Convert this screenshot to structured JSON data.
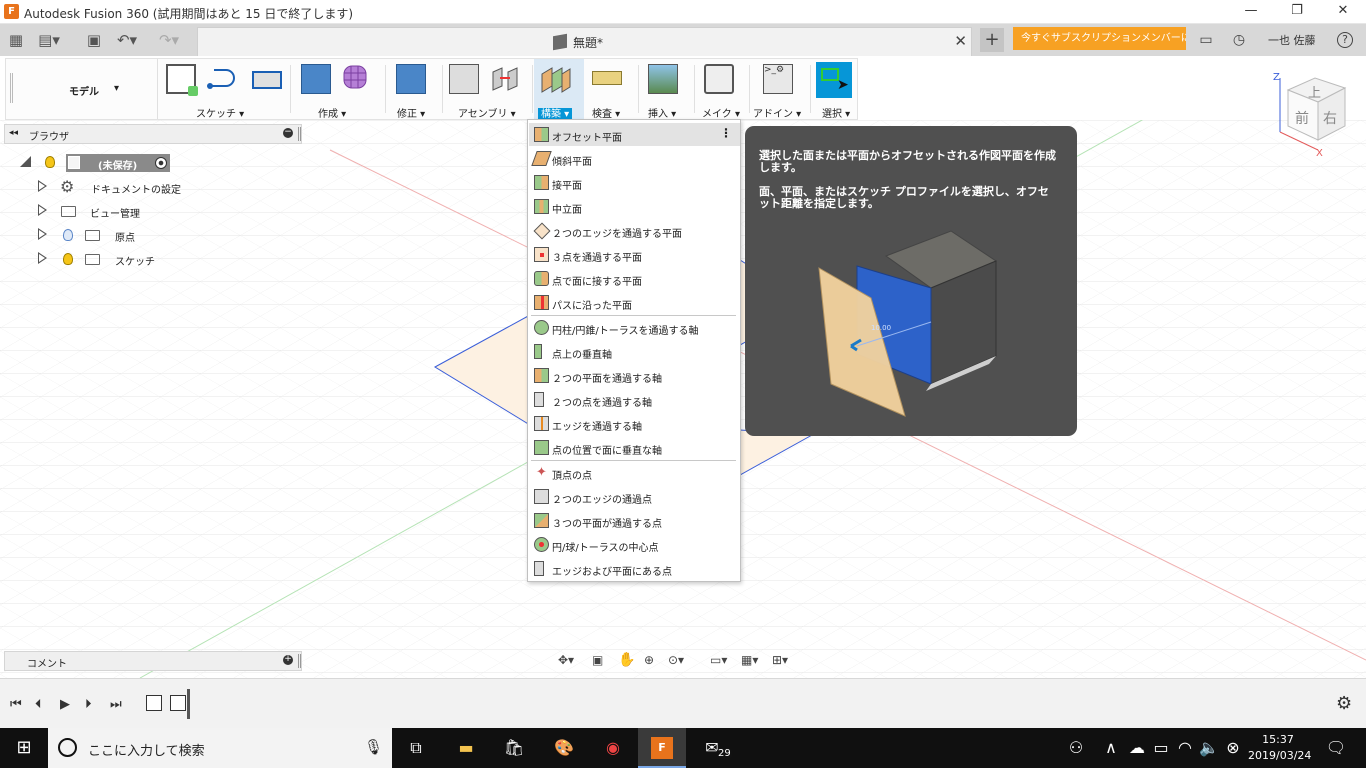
{
  "app": {
    "title": "Autodesk Fusion 360 (試用期間はあと 15 日で終了します)",
    "logo_letter": "F",
    "window_buttons": [
      "—",
      "❐",
      "✕"
    ]
  },
  "tabbar": {
    "doc_title": "無題*",
    "close": "✕",
    "new_tab": "+",
    "subscribe": "今すぐサブスクリプションメンバーに...",
    "user": "一也 佐藤",
    "help": "?"
  },
  "toolbar": {
    "mode_label": "モデル",
    "groups": [
      {
        "label": "スケッチ"
      },
      {
        "label": "作成"
      },
      {
        "label": "修正"
      },
      {
        "label": "アセンブリ"
      },
      {
        "label": "構築"
      },
      {
        "label": "検査"
      },
      {
        "label": "挿入"
      },
      {
        "label": "メイク"
      },
      {
        "label": "アドイン"
      },
      {
        "label": "選択"
      }
    ]
  },
  "browser": {
    "title": "ブラウザ",
    "items": [
      {
        "label": "(未保存)"
      },
      {
        "label": "ドキュメントの設定"
      },
      {
        "label": "ビュー管理"
      },
      {
        "label": "原点"
      },
      {
        "label": "スケッチ"
      }
    ]
  },
  "comment": {
    "label": "コメント"
  },
  "menu": {
    "items": [
      {
        "label": "オフセット平面"
      },
      {
        "label": "傾斜平面"
      },
      {
        "label": "接平面"
      },
      {
        "label": "中立面"
      },
      {
        "label": "２つのエッジを通過する平面"
      },
      {
        "label": "３点を通過する平面"
      },
      {
        "label": "点で面に接する平面"
      },
      {
        "label": "パスに沿った平面"
      },
      {
        "label": "円柱/円錐/トーラスを通過する軸"
      },
      {
        "label": "点上の垂直軸"
      },
      {
        "label": "２つの平面を通過する軸"
      },
      {
        "label": "２つの点を通過する軸"
      },
      {
        "label": "エッジを通過する軸"
      },
      {
        "label": "点の位置で面に垂直な軸"
      },
      {
        "label": "頂点の点"
      },
      {
        "label": "２つのエッジの通過点"
      },
      {
        "label": "３つの平面が通過する点"
      },
      {
        "label": "円/球/トーラスの中心点"
      },
      {
        "label": "エッジおよび平面にある点"
      }
    ]
  },
  "tooltip": {
    "line1": "選択した面または平面からオフセットされる作図平面を作成します。",
    "line2": "面、平面、またはスケッチ プロファイルを選択し、オフセット距離を指定します。",
    "dim_value": "10.00"
  },
  "viewcube": {
    "top": "上",
    "front": "前",
    "right": "右",
    "z": "Z",
    "x": "X"
  },
  "taskbar": {
    "search_placeholder": "ここに入力して検索",
    "time": "15:37",
    "date": "2019/03/24",
    "mail_badge": "29"
  },
  "colors": {
    "accent": "#0696d7",
    "subscribe": "#f7a123",
    "tooltip_bg": "#505050",
    "brand": "#e8731c"
  }
}
